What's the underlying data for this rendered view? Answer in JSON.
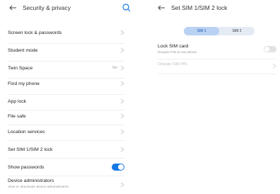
{
  "left_screen": {
    "title": "Security & privacy",
    "items": [
      {
        "label": "Screen lock & passwords"
      },
      {
        "label": "Student mode"
      },
      {
        "label": "Twin Space",
        "value": "Me"
      },
      {
        "label": "Find my phone"
      },
      {
        "label": "App lock"
      },
      {
        "label": "File safe"
      },
      {
        "label": "Location services"
      },
      {
        "label": "Set SIM 1/SIM 2 lock"
      },
      {
        "label": "Show passwords"
      },
      {
        "label": "Device administrators",
        "sublabel": "View or deactivate device administrators"
      }
    ]
  },
  "right_screen": {
    "title": "Set SIM 1/SIM 2 lock",
    "tabs": [
      "SIM 1",
      "SIM 2"
    ],
    "lock_sim": {
      "label": "Lock SIM card",
      "sublabel": "Require PIN to use phone"
    },
    "change_pin": {
      "label": "Change SIM PIN"
    }
  },
  "colors": {
    "accent": "#1677e6"
  }
}
